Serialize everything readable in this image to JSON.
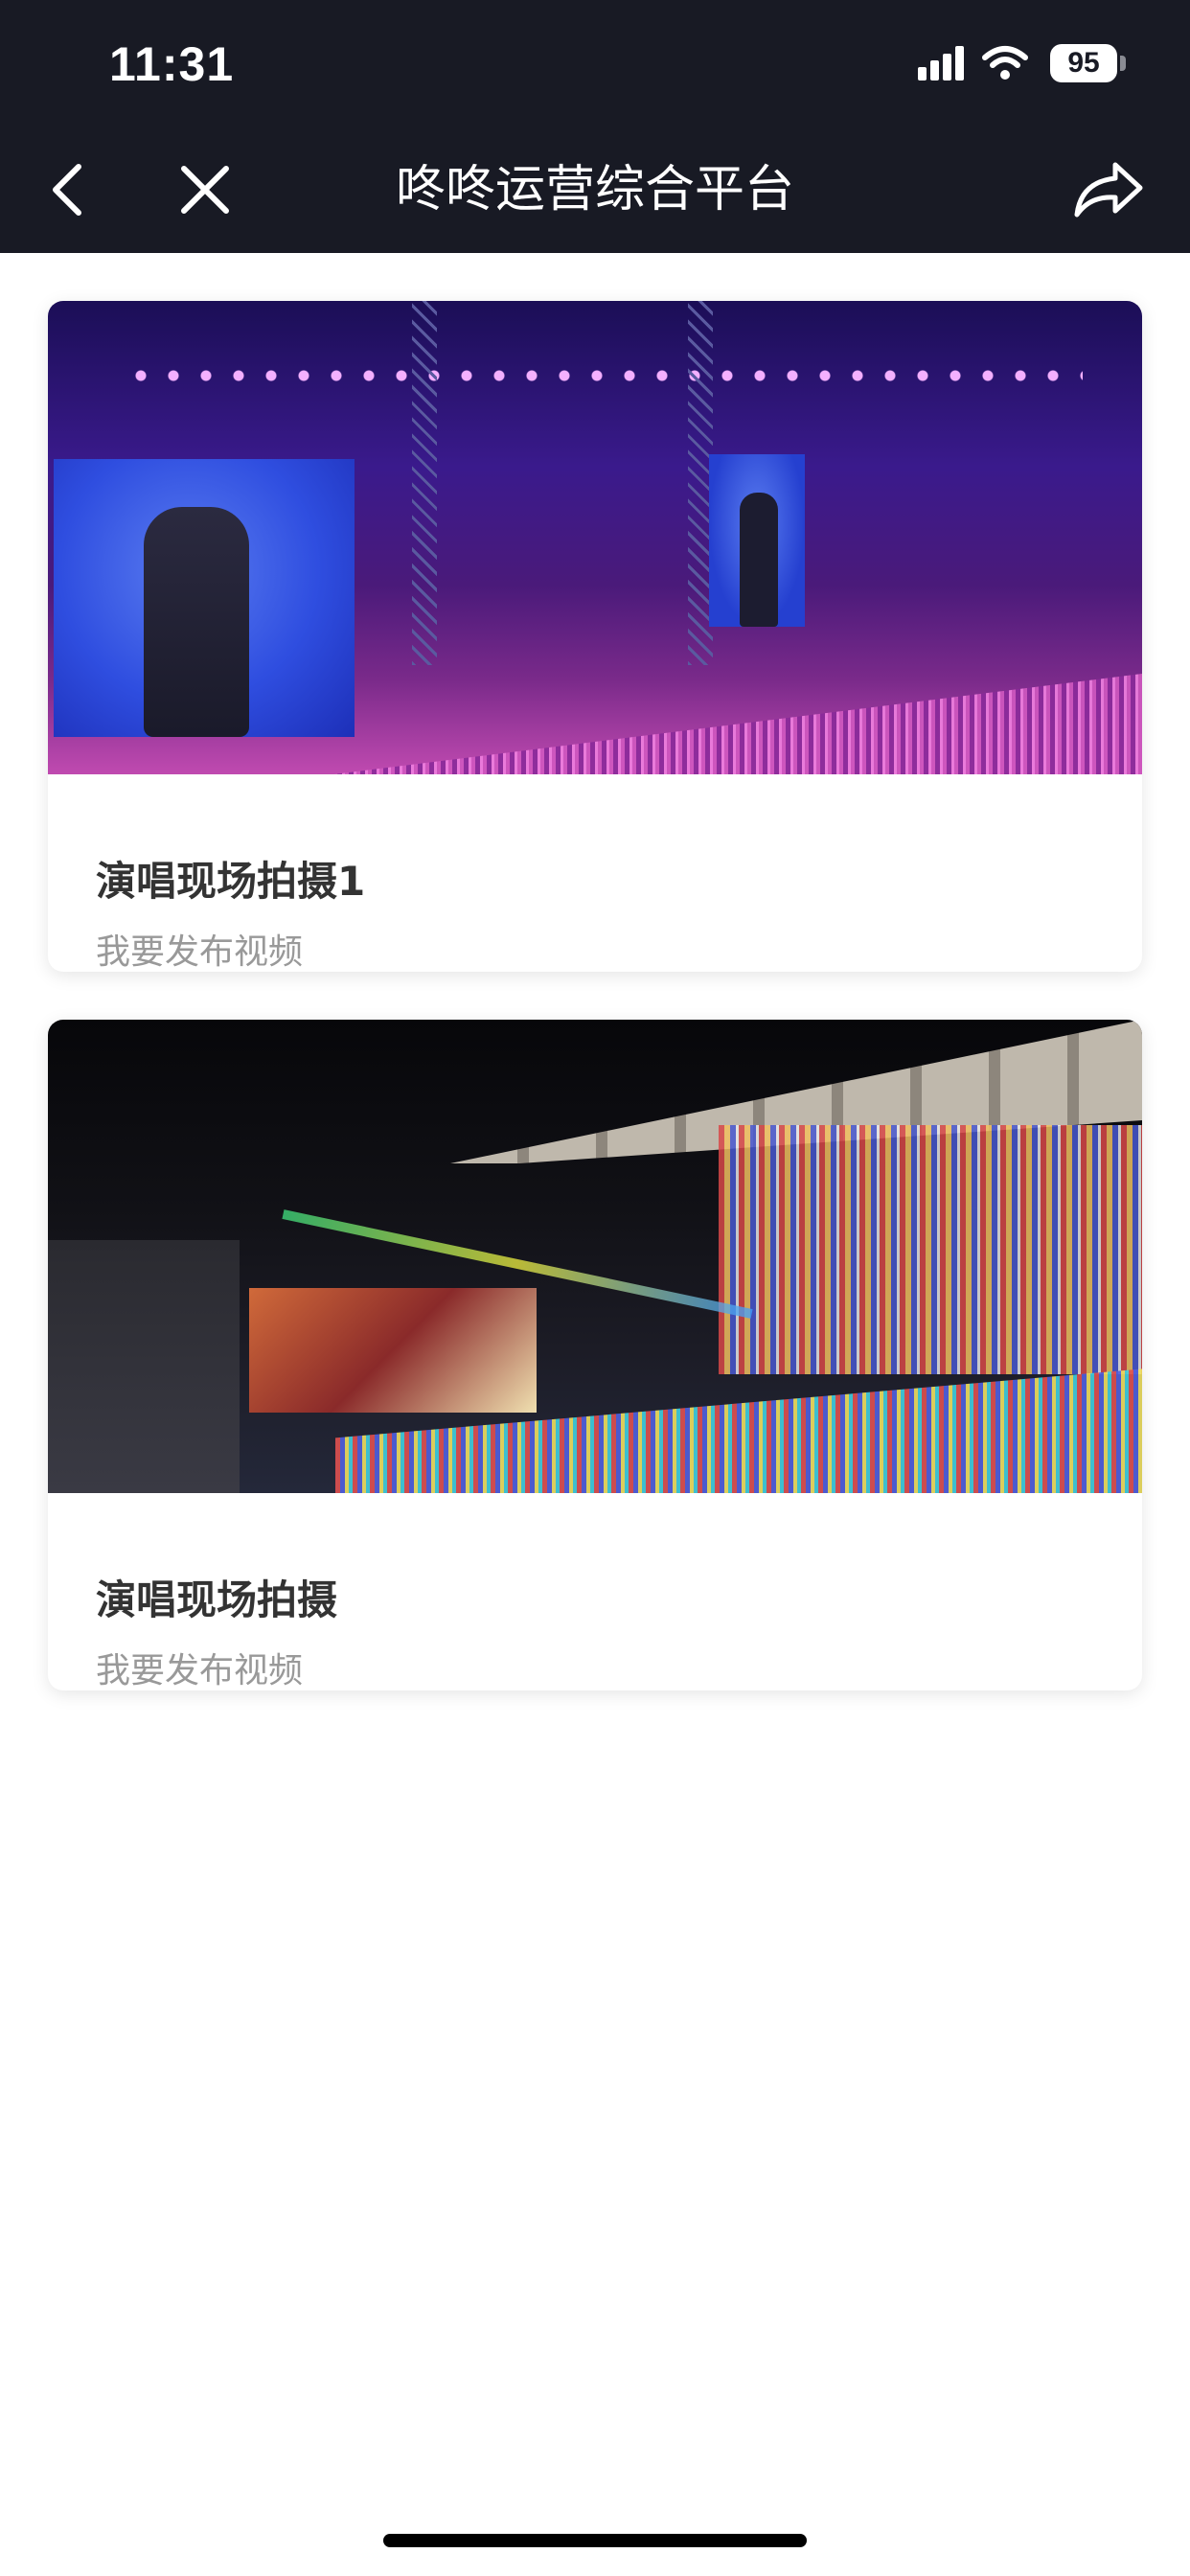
{
  "status_bar": {
    "time": "11:31",
    "battery": "95"
  },
  "nav": {
    "title": "咚咚运营综合平台",
    "icons": [
      "chevron-left-icon",
      "close-icon",
      "share-icon"
    ]
  },
  "cards": [
    {
      "title": "演唱现场拍摄1",
      "subtitle": "我要发布视频",
      "image": "concert-stage-purple"
    },
    {
      "title": "演唱现场拍摄",
      "subtitle": "我要发布视频",
      "image": "concert-stadium-night"
    }
  ],
  "colors": {
    "topbar_bg": "#181a24",
    "title_text": "#333333",
    "subtitle_text": "#999999"
  }
}
